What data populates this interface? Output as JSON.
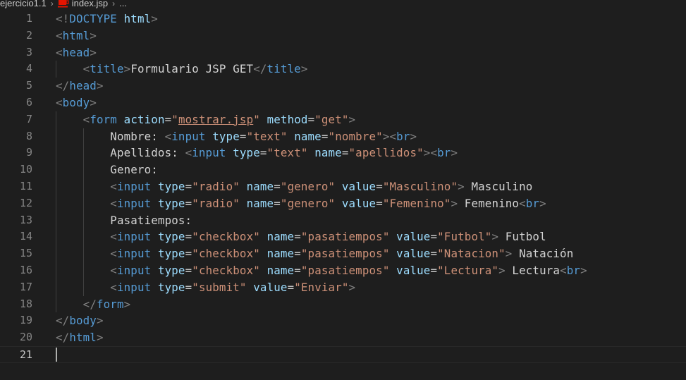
{
  "breadcrumb": {
    "folder": "ejercicio1.1",
    "file": "index.jsp",
    "more": "...",
    "file_icon": "jsp-file-icon",
    "file_icon_color": "#e51400"
  },
  "editor": {
    "active_line": 21,
    "colors": {
      "background": "#1e1e1e",
      "tag": "#569cd6",
      "attribute": "#9cdcfe",
      "string": "#ce9178",
      "text": "#d4d4d4",
      "punctuation": "#808080",
      "line_number": "#858585"
    },
    "lines": [
      {
        "n": "1",
        "tokens": [
          [
            "punc",
            "<!"
          ],
          [
            "tag",
            "DOCTYPE"
          ],
          [
            "text",
            " "
          ],
          [
            "attr",
            "html"
          ],
          [
            "punc",
            ">"
          ]
        ]
      },
      {
        "n": "2",
        "tokens": [
          [
            "punc",
            "<"
          ],
          [
            "tag",
            "html"
          ],
          [
            "punc",
            ">"
          ]
        ]
      },
      {
        "n": "3",
        "tokens": [
          [
            "punc",
            "<"
          ],
          [
            "tag",
            "head"
          ],
          [
            "punc",
            ">"
          ]
        ]
      },
      {
        "n": "4",
        "tokens": [
          [
            "text",
            "    "
          ],
          [
            "punc",
            "<"
          ],
          [
            "tag",
            "title"
          ],
          [
            "punc",
            ">"
          ],
          [
            "text",
            "Formulario JSP GET"
          ],
          [
            "punc",
            "</"
          ],
          [
            "tag",
            "title"
          ],
          [
            "punc",
            ">"
          ]
        ]
      },
      {
        "n": "5",
        "tokens": [
          [
            "punc",
            "</"
          ],
          [
            "tag",
            "head"
          ],
          [
            "punc",
            ">"
          ]
        ]
      },
      {
        "n": "6",
        "tokens": [
          [
            "punc",
            "<"
          ],
          [
            "tag",
            "body"
          ],
          [
            "punc",
            ">"
          ]
        ]
      },
      {
        "n": "7",
        "tokens": [
          [
            "text",
            "    "
          ],
          [
            "punc",
            "<"
          ],
          [
            "tag",
            "form"
          ],
          [
            "text",
            " "
          ],
          [
            "attr",
            "action"
          ],
          [
            "text",
            "="
          ],
          [
            "str",
            "\""
          ],
          [
            "url",
            "mostrar.jsp"
          ],
          [
            "str",
            "\""
          ],
          [
            "text",
            " "
          ],
          [
            "attr",
            "method"
          ],
          [
            "text",
            "="
          ],
          [
            "str",
            "\"get\""
          ],
          [
            "punc",
            ">"
          ]
        ]
      },
      {
        "n": "8",
        "tokens": [
          [
            "text",
            "        Nombre: "
          ],
          [
            "punc",
            "<"
          ],
          [
            "tag",
            "input"
          ],
          [
            "text",
            " "
          ],
          [
            "attr",
            "type"
          ],
          [
            "text",
            "="
          ],
          [
            "str",
            "\"text\""
          ],
          [
            "text",
            " "
          ],
          [
            "attr",
            "name"
          ],
          [
            "text",
            "="
          ],
          [
            "str",
            "\"nombre\""
          ],
          [
            "punc",
            ">"
          ],
          [
            "punc",
            "<"
          ],
          [
            "tag",
            "br"
          ],
          [
            "punc",
            ">"
          ]
        ]
      },
      {
        "n": "9",
        "tokens": [
          [
            "text",
            "        Apellidos: "
          ],
          [
            "punc",
            "<"
          ],
          [
            "tag",
            "input"
          ],
          [
            "text",
            " "
          ],
          [
            "attr",
            "type"
          ],
          [
            "text",
            "="
          ],
          [
            "str",
            "\"text\""
          ],
          [
            "text",
            " "
          ],
          [
            "attr",
            "name"
          ],
          [
            "text",
            "="
          ],
          [
            "str",
            "\"apellidos\""
          ],
          [
            "punc",
            ">"
          ],
          [
            "punc",
            "<"
          ],
          [
            "tag",
            "br"
          ],
          [
            "punc",
            ">"
          ]
        ]
      },
      {
        "n": "10",
        "tokens": [
          [
            "text",
            "        Genero:"
          ]
        ]
      },
      {
        "n": "11",
        "tokens": [
          [
            "text",
            "        "
          ],
          [
            "punc",
            "<"
          ],
          [
            "tag",
            "input"
          ],
          [
            "text",
            " "
          ],
          [
            "attr",
            "type"
          ],
          [
            "text",
            "="
          ],
          [
            "str",
            "\"radio\""
          ],
          [
            "text",
            " "
          ],
          [
            "attr",
            "name"
          ],
          [
            "text",
            "="
          ],
          [
            "str",
            "\"genero\""
          ],
          [
            "text",
            " "
          ],
          [
            "attr",
            "value"
          ],
          [
            "text",
            "="
          ],
          [
            "str",
            "\"Masculino\""
          ],
          [
            "punc",
            ">"
          ],
          [
            "text",
            " Masculino"
          ]
        ]
      },
      {
        "n": "12",
        "tokens": [
          [
            "text",
            "        "
          ],
          [
            "punc",
            "<"
          ],
          [
            "tag",
            "input"
          ],
          [
            "text",
            " "
          ],
          [
            "attr",
            "type"
          ],
          [
            "text",
            "="
          ],
          [
            "str",
            "\"radio\""
          ],
          [
            "text",
            " "
          ],
          [
            "attr",
            "name"
          ],
          [
            "text",
            "="
          ],
          [
            "str",
            "\"genero\""
          ],
          [
            "text",
            " "
          ],
          [
            "attr",
            "value"
          ],
          [
            "text",
            "="
          ],
          [
            "str",
            "\"Femenino\""
          ],
          [
            "punc",
            ">"
          ],
          [
            "text",
            " Femenino"
          ],
          [
            "punc",
            "<"
          ],
          [
            "tag",
            "br"
          ],
          [
            "punc",
            ">"
          ]
        ]
      },
      {
        "n": "13",
        "tokens": [
          [
            "text",
            "        Pasatiempos:"
          ]
        ]
      },
      {
        "n": "14",
        "tokens": [
          [
            "text",
            "        "
          ],
          [
            "punc",
            "<"
          ],
          [
            "tag",
            "input"
          ],
          [
            "text",
            " "
          ],
          [
            "attr",
            "type"
          ],
          [
            "text",
            "="
          ],
          [
            "str",
            "\"checkbox\""
          ],
          [
            "text",
            " "
          ],
          [
            "attr",
            "name"
          ],
          [
            "text",
            "="
          ],
          [
            "str",
            "\"pasatiempos\""
          ],
          [
            "text",
            " "
          ],
          [
            "attr",
            "value"
          ],
          [
            "text",
            "="
          ],
          [
            "str",
            "\"Futbol\""
          ],
          [
            "punc",
            ">"
          ],
          [
            "text",
            " Futbol"
          ]
        ]
      },
      {
        "n": "15",
        "tokens": [
          [
            "text",
            "        "
          ],
          [
            "punc",
            "<"
          ],
          [
            "tag",
            "input"
          ],
          [
            "text",
            " "
          ],
          [
            "attr",
            "type"
          ],
          [
            "text",
            "="
          ],
          [
            "str",
            "\"checkbox\""
          ],
          [
            "text",
            " "
          ],
          [
            "attr",
            "name"
          ],
          [
            "text",
            "="
          ],
          [
            "str",
            "\"pasatiempos\""
          ],
          [
            "text",
            " "
          ],
          [
            "attr",
            "value"
          ],
          [
            "text",
            "="
          ],
          [
            "str",
            "\"Natacion\""
          ],
          [
            "punc",
            ">"
          ],
          [
            "text",
            " Natación"
          ]
        ]
      },
      {
        "n": "16",
        "tokens": [
          [
            "text",
            "        "
          ],
          [
            "punc",
            "<"
          ],
          [
            "tag",
            "input"
          ],
          [
            "text",
            " "
          ],
          [
            "attr",
            "type"
          ],
          [
            "text",
            "="
          ],
          [
            "str",
            "\"checkbox\""
          ],
          [
            "text",
            " "
          ],
          [
            "attr",
            "name"
          ],
          [
            "text",
            "="
          ],
          [
            "str",
            "\"pasatiempos\""
          ],
          [
            "text",
            " "
          ],
          [
            "attr",
            "value"
          ],
          [
            "text",
            "="
          ],
          [
            "str",
            "\"Lectura\""
          ],
          [
            "punc",
            ">"
          ],
          [
            "text",
            " Lectura"
          ],
          [
            "punc",
            "<"
          ],
          [
            "tag",
            "br"
          ],
          [
            "punc",
            ">"
          ]
        ]
      },
      {
        "n": "17",
        "tokens": [
          [
            "text",
            "        "
          ],
          [
            "punc",
            "<"
          ],
          [
            "tag",
            "input"
          ],
          [
            "text",
            " "
          ],
          [
            "attr",
            "type"
          ],
          [
            "text",
            "="
          ],
          [
            "str",
            "\"submit\""
          ],
          [
            "text",
            " "
          ],
          [
            "attr",
            "value"
          ],
          [
            "text",
            "="
          ],
          [
            "str",
            "\"Enviar\""
          ],
          [
            "punc",
            ">"
          ]
        ]
      },
      {
        "n": "18",
        "tokens": [
          [
            "text",
            "    "
          ],
          [
            "punc",
            "</"
          ],
          [
            "tag",
            "form"
          ],
          [
            "punc",
            ">"
          ]
        ]
      },
      {
        "n": "19",
        "tokens": [
          [
            "punc",
            "</"
          ],
          [
            "tag",
            "body"
          ],
          [
            "punc",
            ">"
          ]
        ]
      },
      {
        "n": "20",
        "tokens": [
          [
            "punc",
            "</"
          ],
          [
            "tag",
            "html"
          ],
          [
            "punc",
            ">"
          ]
        ]
      },
      {
        "n": "21",
        "tokens": []
      }
    ]
  }
}
